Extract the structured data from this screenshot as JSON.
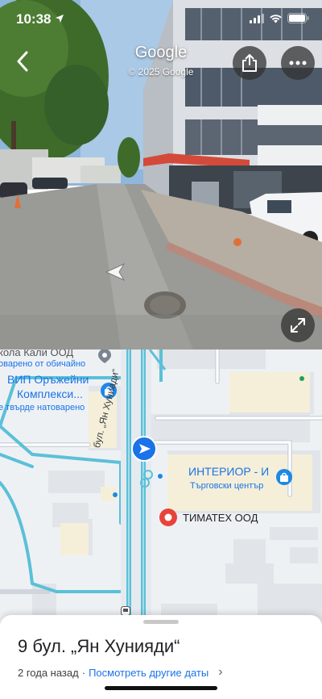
{
  "status_bar": {
    "time": "10:38"
  },
  "street_view": {
    "title": "Google",
    "copyright": "© 2025 Google"
  },
  "map": {
    "labels": {
      "school_top": "кола Кали ООД",
      "traffic_normal": "оварено от обичайно",
      "vip_line1": "ВИП Оръжейни",
      "vip_line2": "Комплекси...",
      "traffic_heavy": "е твърде натоварено",
      "street_name": "бул. „Ян Хуниади“",
      "interior_name": "ИНТЕРИОР - И",
      "interior_sub": "Търговски център",
      "timatex": "ТИМАТЕХ ООД"
    },
    "colors": {
      "road_blue": "#5bc0d8",
      "pin_red": "#e8433b",
      "poi_blue": "#1e88e5",
      "traffic_text": "#1a73e8"
    }
  },
  "sheet": {
    "title": "9 бул. „Ян Хунияди“",
    "time_ago": "2 года назад",
    "separator": "·",
    "more_dates": "Посмотреть другие даты",
    "chevron": "›"
  }
}
